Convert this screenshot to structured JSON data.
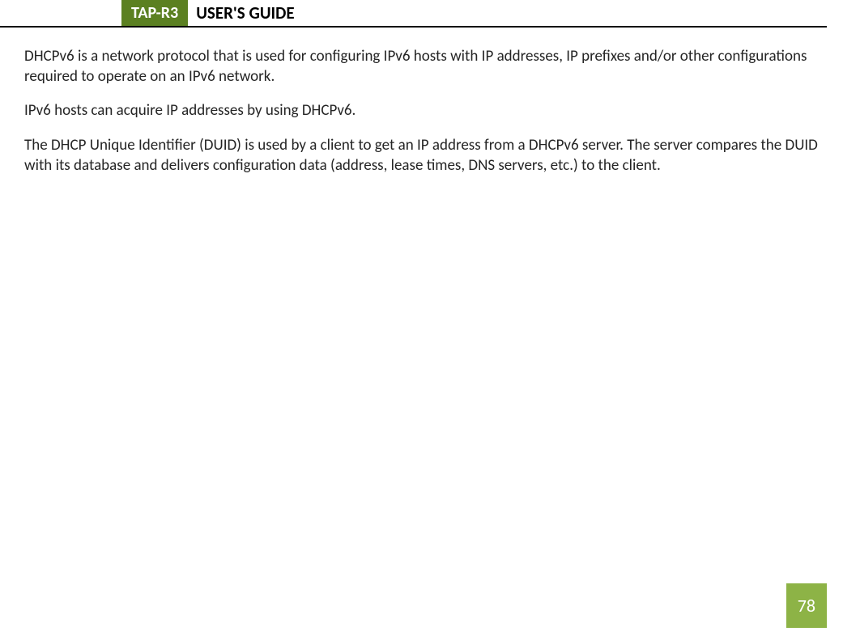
{
  "header": {
    "badge": "TAP-R3",
    "title": "USER'S GUIDE"
  },
  "body": {
    "p1": "DHCPv6 is a network protocol that is used for configuring IPv6 hosts with IP addresses, IP prefixes and/or other configurations required to operate on an IPv6 network.",
    "p2": "IPv6 hosts can acquire IP addresses by using DHCPv6.",
    "p3": "The DHCP Unique Identifier (DUID) is used by a client to get an IP address from a DHCPv6 server. The server compares the DUID with its database and delivers configuration data (address, lease times, DNS servers, etc.) to the client."
  },
  "page_number": "78"
}
